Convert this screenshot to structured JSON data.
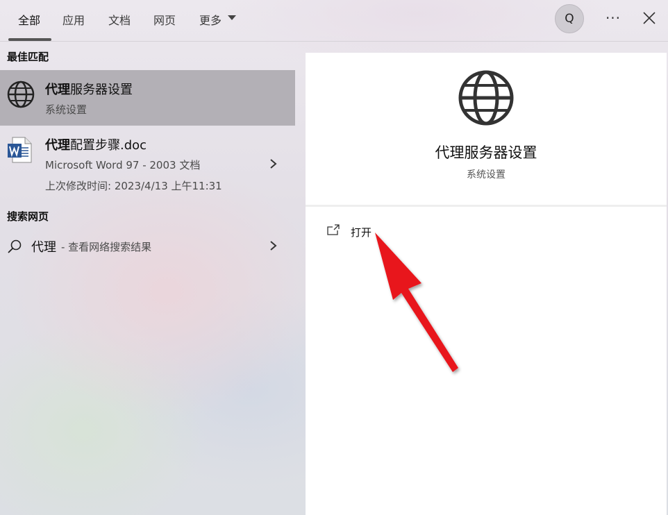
{
  "tabs": {
    "all": "全部",
    "apps": "应用",
    "docs": "文档",
    "web": "网页",
    "more": "更多"
  },
  "header": {
    "avatar_letter": "Q",
    "more_options": "···"
  },
  "best_match": {
    "section_title": "最佳匹配",
    "title_bold": "代理",
    "title_rest": "服务器设置",
    "subtitle": "系统设置",
    "icon": "globe-icon"
  },
  "document": {
    "title_bold": "代理",
    "title_rest": "配置步骤.doc",
    "app": "Microsoft Word 97 - 2003 文档",
    "modified": "上次修改时间: 2023/4/13 上午11:31",
    "icon": "word-doc-icon"
  },
  "web_search": {
    "section_title": "搜索网页",
    "query": "代理",
    "description": "- 查看网络搜索结果",
    "icon": "search-icon"
  },
  "detail": {
    "title": "代理服务器设置",
    "subtitle": "系统设置",
    "open_label": "打开",
    "icon": "globe-icon"
  },
  "annotation": {
    "arrow_color": "#e8141b"
  }
}
